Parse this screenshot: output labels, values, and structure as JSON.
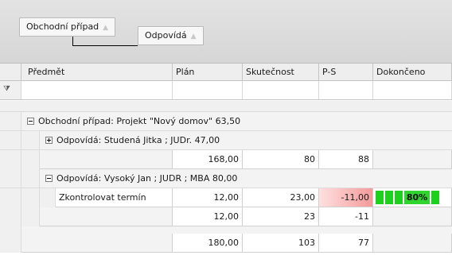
{
  "group_panel": {
    "chips": [
      {
        "label": "Obchodní případ",
        "sort_icon": "sort-ascending-icon"
      },
      {
        "label": "Odpovídá",
        "sort_icon": "sort-ascending-icon"
      }
    ],
    "sort_glyph": "▲"
  },
  "columns": [
    {
      "label": "Předmět"
    },
    {
      "label": "Plán"
    },
    {
      "label": "Skutečnost"
    },
    {
      "label": "P-S"
    },
    {
      "label": "Dokončeno"
    }
  ],
  "filter_row": {
    "icon": "filter-icon"
  },
  "groups": {
    "case": {
      "label": "Obchodní případ: Projekt \"Nový domov\" 63,50",
      "expanded": true
    },
    "owner1": {
      "label": "Odpovídá: Studená Jitka ; JUDr. 47,00",
      "expanded": false,
      "summary": {
        "plan": "168,00",
        "actual": "80",
        "diff": "88"
      }
    },
    "owner2": {
      "label": "Odpovídá: Vysoký Jan ; JUDR ; MBA 80,00",
      "expanded": true,
      "rows": [
        {
          "subject": "Zkontrolovat termín",
          "plan": "12,00",
          "actual": "23,00",
          "diff": "-11,00",
          "done_pct": 80,
          "done_label": "80%"
        }
      ],
      "summary": {
        "plan": "12,00",
        "actual": "23",
        "diff": "-11"
      }
    },
    "case_summary": {
      "plan": "180,00",
      "actual": "103",
      "diff": "77"
    }
  },
  "colors": {
    "negative": "#f49a9a",
    "progress": "#1fcf1f"
  }
}
